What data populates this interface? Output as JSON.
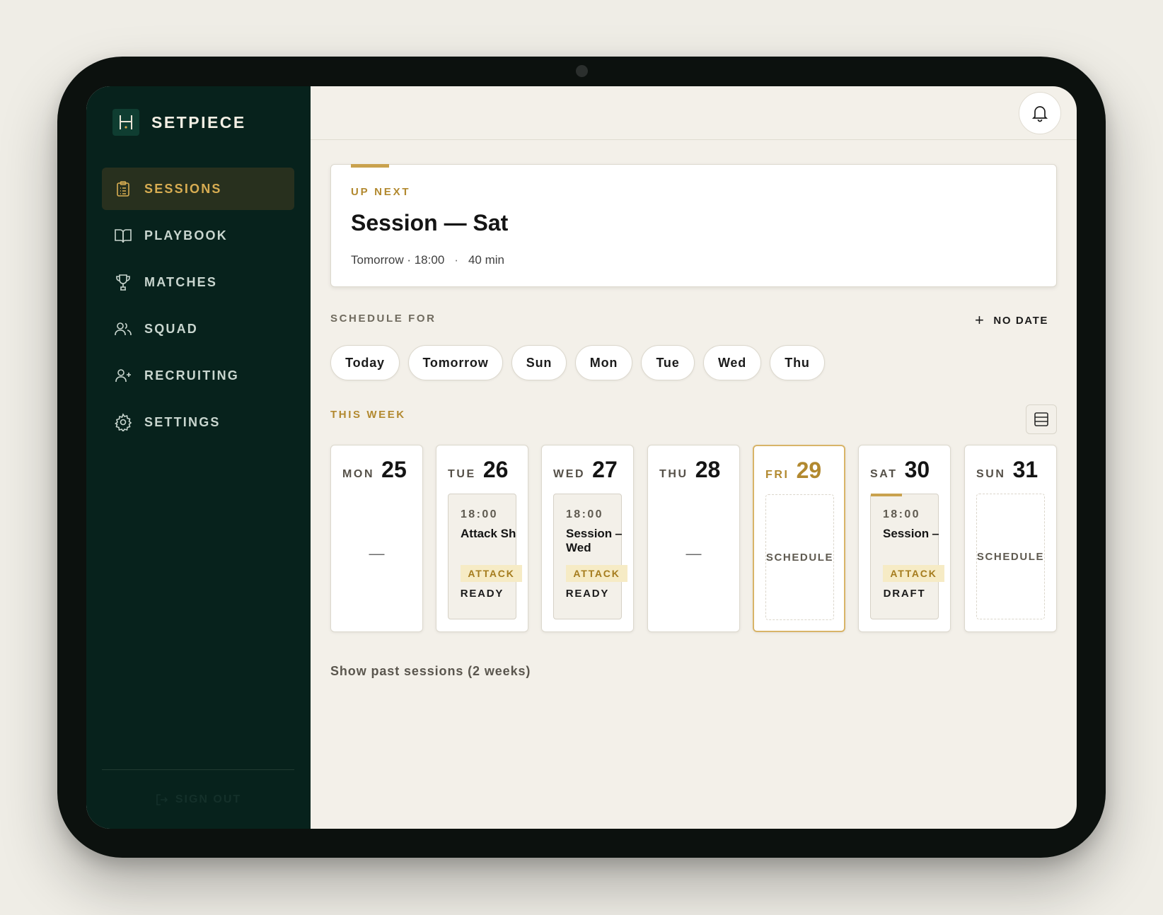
{
  "app": {
    "name": "SETPIECE",
    "logo_icon": "goalpost-icon"
  },
  "colors": {
    "sidebar_bg": "#07221c",
    "accent_gold": "#c9a24e",
    "main_bg": "#f3f0e9"
  },
  "sidebar": {
    "items": [
      {
        "label": "SESSIONS",
        "icon": "clipboard-icon",
        "active": true
      },
      {
        "label": "PLAYBOOK",
        "icon": "book-icon",
        "active": false
      },
      {
        "label": "MATCHES",
        "icon": "trophy-icon",
        "active": false
      },
      {
        "label": "SQUAD",
        "icon": "users-icon",
        "active": false
      },
      {
        "label": "RECRUITING",
        "icon": "user-plus-icon",
        "active": false
      },
      {
        "label": "SETTINGS",
        "icon": "gear-icon",
        "active": false
      }
    ],
    "signout_label": "SIGN OUT"
  },
  "header": {
    "notification_icon": "bell-icon"
  },
  "up_next": {
    "eyebrow": "UP NEXT",
    "title": "Session — Sat",
    "when": "Tomorrow · 18:00",
    "separator": "·",
    "duration": "40 min"
  },
  "schedule_for": {
    "label": "SCHEDULE FOR",
    "no_date_label": "NO DATE",
    "chips": [
      "Today",
      "Tomorrow",
      "Sun",
      "Mon",
      "Tue",
      "Wed",
      "Thu"
    ]
  },
  "this_week": {
    "label": "THIS WEEK",
    "days": [
      {
        "name": "MON",
        "num": "25",
        "kind": "empty",
        "placeholder": "—"
      },
      {
        "name": "TUE",
        "num": "26",
        "kind": "session",
        "time": "18:00",
        "title": "Attack Shap...",
        "tag": "ATTACK",
        "status": "READY"
      },
      {
        "name": "WED",
        "num": "27",
        "kind": "session",
        "time": "18:00",
        "title": "Session — Wed",
        "tag": "ATTACK",
        "status": "READY"
      },
      {
        "name": "THU",
        "num": "28",
        "kind": "empty",
        "placeholder": "—"
      },
      {
        "name": "FRI",
        "num": "29",
        "kind": "schedule",
        "today": true,
        "action": "SCHEDULE"
      },
      {
        "name": "SAT",
        "num": "30",
        "kind": "session",
        "upcoming": true,
        "time": "18:00",
        "title": "Session — Sat",
        "tag": "ATTACK",
        "status": "DRAFT"
      },
      {
        "name": "SUN",
        "num": "31",
        "kind": "schedule",
        "action": "SCHEDULE"
      }
    ]
  },
  "past_sessions_label": "Show past sessions (2 weeks)"
}
